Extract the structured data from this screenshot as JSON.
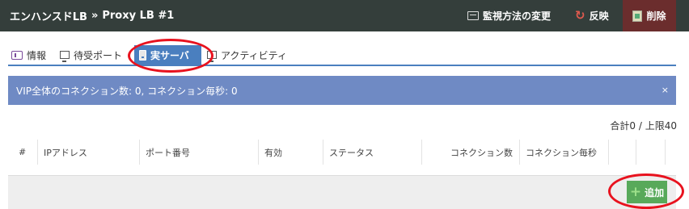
{
  "header": {
    "breadcrumb_root": "エンハンスドLB",
    "breadcrumb_sep": "»",
    "breadcrumb_current": "Proxy LB #1",
    "buttons": {
      "monitor_label": "監視方法の変更",
      "reflect_label": "反映",
      "delete_label": "削除"
    }
  },
  "tabs": [
    {
      "label": "情報",
      "icon": "info-icon"
    },
    {
      "label": "待受ポート",
      "icon": "monitor-icon"
    },
    {
      "label": "実サーバ",
      "icon": "server-icon",
      "active": true
    },
    {
      "label": "アクティビティ",
      "icon": "monitor-icon"
    }
  ],
  "alert": {
    "text": "VIP全体のコネクション数: 0, コネクション毎秒: 0",
    "close": "×"
  },
  "summary": "合計0 / 上限40",
  "table": {
    "columns": [
      "#",
      "IPアドレス",
      "ポート番号",
      "有効",
      "ステータス",
      "コネクション数",
      "コネクション毎秒",
      "",
      ""
    ]
  },
  "footer": {
    "add_label": "追加"
  },
  "colors": {
    "topbar": "#343e3b",
    "tab_active": "#4a7fbf",
    "alert": "#6f8ac4",
    "add_button": "#58a95a",
    "delete_button_bg": "#6b2d2d",
    "annotation_ring": "#e8121e"
  }
}
